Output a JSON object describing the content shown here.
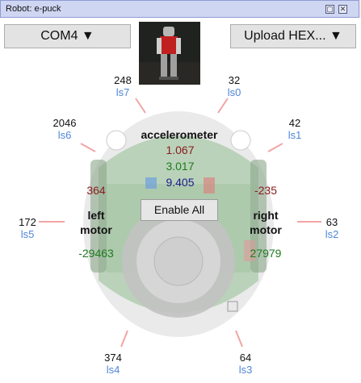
{
  "window": {
    "title": "Robot: e-puck"
  },
  "toolbar": {
    "port_label": "COM4 ▼",
    "upload_label": "Upload HEX... ▼"
  },
  "sensors": {
    "ls0": {
      "value": "32",
      "name": "ls0"
    },
    "ls1": {
      "value": "42",
      "name": "ls1"
    },
    "ls2": {
      "value": "63",
      "name": "ls2"
    },
    "ls3": {
      "value": "64",
      "name": "ls3"
    },
    "ls4": {
      "value": "374",
      "name": "ls4"
    },
    "ls5": {
      "value": "172",
      "name": "ls5"
    },
    "ls6": {
      "value": "2046",
      "name": "ls6"
    },
    "ls7": {
      "value": "248",
      "name": "ls7"
    }
  },
  "accelerometer": {
    "label": "accelerometer",
    "x": "1.067",
    "y": "3.017",
    "z": "9.405"
  },
  "left_motor": {
    "label_line1": "left",
    "label_line2": "motor",
    "speed": "364",
    "position": "-29463"
  },
  "right_motor": {
    "label_line1": "right",
    "label_line2": "motor",
    "speed": "-235",
    "position": "27979"
  },
  "enable_all_label": "Enable All",
  "colors": {
    "x": "#8b1a1a",
    "y": "#1e7a1e",
    "z": "#1a1a8b",
    "sensor_name": "#4f86d8",
    "sensor_line": "#f0a0a0"
  }
}
